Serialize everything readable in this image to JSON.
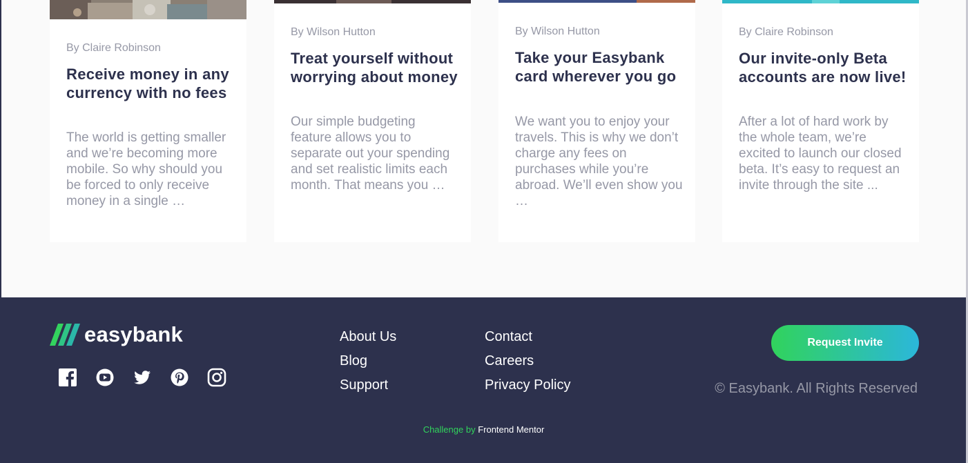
{
  "articles": [
    {
      "author": "By Claire Robinson",
      "title": "Receive money in any currency with no fees",
      "excerpt": "The world is getting smaller and we’re becoming more mobile. So why should you be forced to only receive money in a single …",
      "image": "currency-notes-image"
    },
    {
      "author": "By Wilson Hutton",
      "title": "Treat yourself without worrying about money",
      "excerpt": "Our simple budgeting feature allows you to separate out your spending and set realistic limits each month. That means you …",
      "image": "restaurant-image"
    },
    {
      "author": "By Wilson Hutton",
      "title": "Take your Easybank card wherever you go",
      "excerpt": "We want you to enjoy your travels. This is why we don’t charge any fees on purchases while you’re abroad. We’ll even show you …",
      "image": "plane-image"
    },
    {
      "author": "By Claire Robinson",
      "title": "Our invite-only Beta accounts are now live!",
      "excerpt": "After a lot of hard work by the whole team, we’re excited to launch our closed beta. It’s easy to request an invite through the site ...",
      "image": "confetti-image"
    }
  ],
  "footer": {
    "logo_text": "easybank",
    "social_icons": [
      "facebook-icon",
      "youtube-icon",
      "twitter-icon",
      "pinterest-icon",
      "instagram-icon"
    ],
    "links_col1": [
      "About Us",
      "Blog",
      "Support"
    ],
    "links_col2": [
      "Contact",
      "Careers",
      "Privacy Policy"
    ],
    "cta_label": "Request Invite",
    "copyright": "© Easybank. All Rights Reserved",
    "attribution_lead": "Challenge by",
    "attribution_link": "Frontend Mentor"
  },
  "colors": {
    "dark_blue": "#2d314d",
    "lime_green": "#31d35c",
    "bright_cyan": "#2bb7da",
    "grayish_blue": "#9698a6",
    "light_gray_bg": "#fafafa"
  }
}
